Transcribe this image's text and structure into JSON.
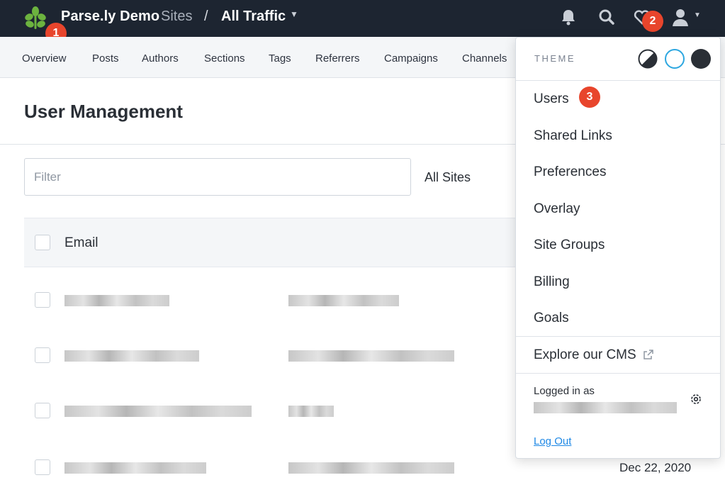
{
  "topbar": {
    "brand": "Parse.ly Demo",
    "sites_label": "Sites",
    "separator": "/",
    "current_view": "All Traffic",
    "caret": "▼"
  },
  "badges": {
    "one": "1",
    "two": "2",
    "three": "3"
  },
  "nav": {
    "items": [
      "Overview",
      "Posts",
      "Authors",
      "Sections",
      "Tags",
      "Referrers",
      "Campaigns",
      "Channels"
    ]
  },
  "page": {
    "title": "User Management",
    "filter_placeholder": "Filter",
    "site_scope": "All Sites",
    "email_header": "Email",
    "last_row_date": "Dec 22, 2020"
  },
  "dropdown": {
    "theme_label": "THEME",
    "items": [
      "Users",
      "Shared Links",
      "Preferences",
      "Overlay",
      "Site Groups",
      "Billing",
      "Goals"
    ],
    "explore": "Explore our CMS",
    "logged_in_as": "Logged in as",
    "logout": "Log Out"
  },
  "colors": {
    "topbar_bg": "#1d2531",
    "badge": "#e8452c",
    "link": "#1e88e5",
    "logo_green": "#6cb33f"
  },
  "icons": [
    "parsely-leaf-icon",
    "bell-icon",
    "search-icon",
    "heart-icon",
    "user-icon",
    "external-link-icon",
    "gear-icon"
  ]
}
